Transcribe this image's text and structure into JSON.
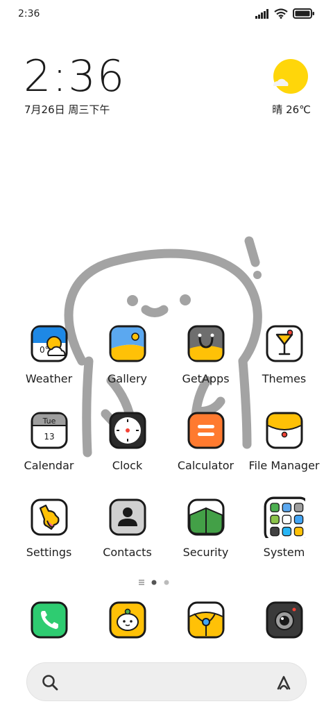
{
  "status_bar": {
    "time": "2:36"
  },
  "clock_widget": {
    "time": "2:36",
    "date": "7月26日 周三下午"
  },
  "weather_widget": {
    "condition_temp": "晴 26℃",
    "icon": "sun-with-cloud-icon"
  },
  "apps": [
    {
      "label": "Weather",
      "icon": "weather-app-icon"
    },
    {
      "label": "Gallery",
      "icon": "gallery-app-icon"
    },
    {
      "label": "GetApps",
      "icon": "getapps-app-icon"
    },
    {
      "label": "Themes",
      "icon": "themes-app-icon"
    },
    {
      "label": "Calendar",
      "icon": "calendar-app-icon",
      "day": "Tue",
      "date": "13"
    },
    {
      "label": "Clock",
      "icon": "clock-app-icon"
    },
    {
      "label": "Calculator",
      "icon": "calculator-app-icon"
    },
    {
      "label": "File Manager",
      "icon": "file-manager-app-icon"
    },
    {
      "label": "Settings",
      "icon": "settings-app-icon"
    },
    {
      "label": "Contacts",
      "icon": "contacts-app-icon"
    },
    {
      "label": "Security",
      "icon": "security-app-icon"
    },
    {
      "label": "System",
      "icon": "system-folder-icon"
    }
  ],
  "page_indicator": {
    "pages": 2,
    "current": 1
  },
  "dock": [
    {
      "icon": "phone-app-icon"
    },
    {
      "icon": "messages-app-icon"
    },
    {
      "icon": "browser-app-icon"
    },
    {
      "icon": "camera-app-icon"
    }
  ],
  "search_bar": {
    "placeholder": ""
  },
  "colors": {
    "accent_yellow": "#FFC107",
    "wallpaper_stroke": "#9e9e9e",
    "outline": "#1a1a1a",
    "search_bg": "#eeeeee"
  }
}
